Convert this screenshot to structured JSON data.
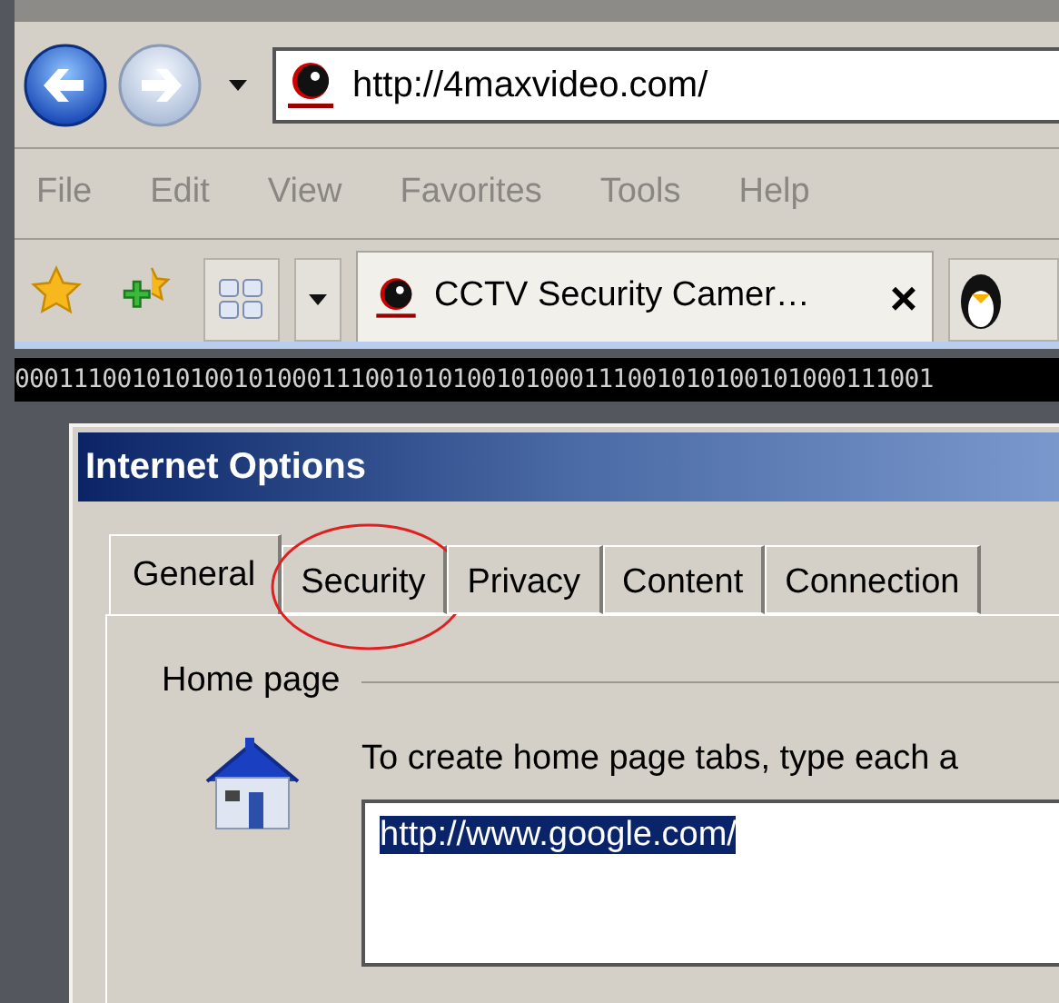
{
  "browser": {
    "address": "http://4maxvideo.com/",
    "menu": [
      {
        "label": "File",
        "disabled": true
      },
      {
        "label": "Edit",
        "disabled": true
      },
      {
        "label": "View",
        "disabled": true
      },
      {
        "label": "Favorites",
        "disabled": true
      },
      {
        "label": "Tools",
        "disabled": true
      },
      {
        "label": "Help",
        "disabled": true
      }
    ],
    "tab": {
      "title": "CCTV Security Camer…",
      "close": "×"
    }
  },
  "banner": {
    "text": "000111001010100101000111001010100101000111001010100101000111001"
  },
  "dialog": {
    "title": "Internet Options",
    "tabs": [
      {
        "label": "General",
        "selected": true
      },
      {
        "label": "Security",
        "selected": false,
        "circled": true
      },
      {
        "label": "Privacy",
        "selected": false
      },
      {
        "label": "Content",
        "selected": false
      },
      {
        "label": "Connection",
        "selected": false
      }
    ],
    "home_page": {
      "legend": "Home page",
      "hint": "To create home page tabs, type each a",
      "value": "http://www.google.com/",
      "value_selected": true
    }
  }
}
